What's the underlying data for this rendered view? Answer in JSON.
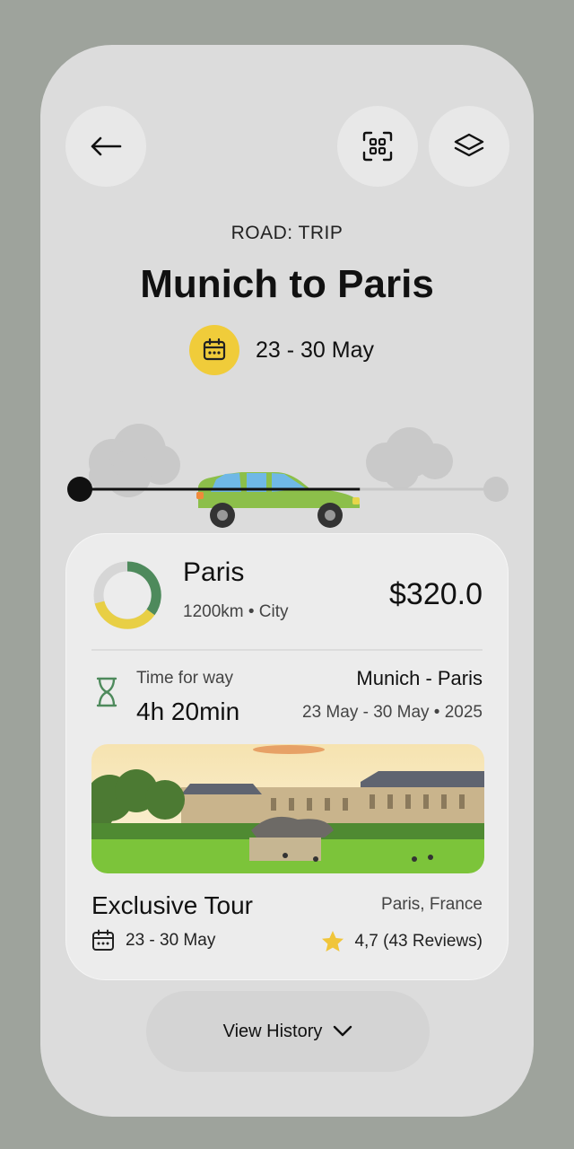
{
  "header": {
    "back_icon": "arrow-left-icon",
    "scan_icon": "qr-scan-icon",
    "layers_icon": "layers-icon"
  },
  "trip": {
    "category": "ROAD: TRIP",
    "title": "Munich to Paris",
    "dates": "23 - 30 May",
    "calendar_color": "#f0cc3a",
    "progress": 0.67
  },
  "card": {
    "destination": "Paris",
    "meta": "1200km • City",
    "price": "$320.0",
    "ring_colors": {
      "primary": "#4e8a5c",
      "secondary": "#e8cf45",
      "track": "#d6d6d6"
    },
    "time_label": "Time for way",
    "time_value": "4h 20min",
    "route": "Munich - Paris",
    "route_dates": "23 May - 30 May • 2025",
    "tour": {
      "name": "Exclusive Tour",
      "location": "Paris, France",
      "dates": "23 - 30 May",
      "rating": "4,7 (43 Reviews)",
      "star_color": "#f0c53a"
    }
  },
  "footer": {
    "history_label": "View History",
    "chevron_icon": "chevron-down-icon"
  }
}
